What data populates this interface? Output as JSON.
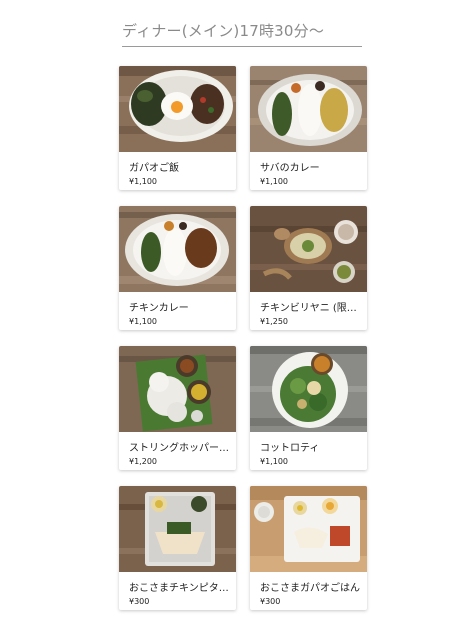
{
  "section": {
    "title": "ディナー(メイン)17時30分〜"
  },
  "menu_items": [
    {
      "name": "ガパオご飯",
      "price": "¥1,100",
      "image": "gapao-rice-photo"
    },
    {
      "name": "サバのカレー",
      "price": "¥1,100",
      "image": "mackerel-curry-photo"
    },
    {
      "name": "チキンカレー",
      "price": "¥1,100",
      "image": "chicken-curry-photo"
    },
    {
      "name": "チキンビリヤニ (限定)",
      "price": "¥1,250",
      "image": "chicken-biryani-photo"
    },
    {
      "name": "ストリングホッパー…",
      "price": "¥1,200",
      "image": "string-hoppers-photo"
    },
    {
      "name": "コットロティ",
      "price": "¥1,100",
      "image": "kottu-roti-photo"
    },
    {
      "name": "おこさまチキンピタ…",
      "price": "¥300",
      "image": "kids-chicken-pita-photo"
    },
    {
      "name": "おこさまガパオごはん",
      "price": "¥300",
      "image": "kids-gapao-photo"
    }
  ]
}
